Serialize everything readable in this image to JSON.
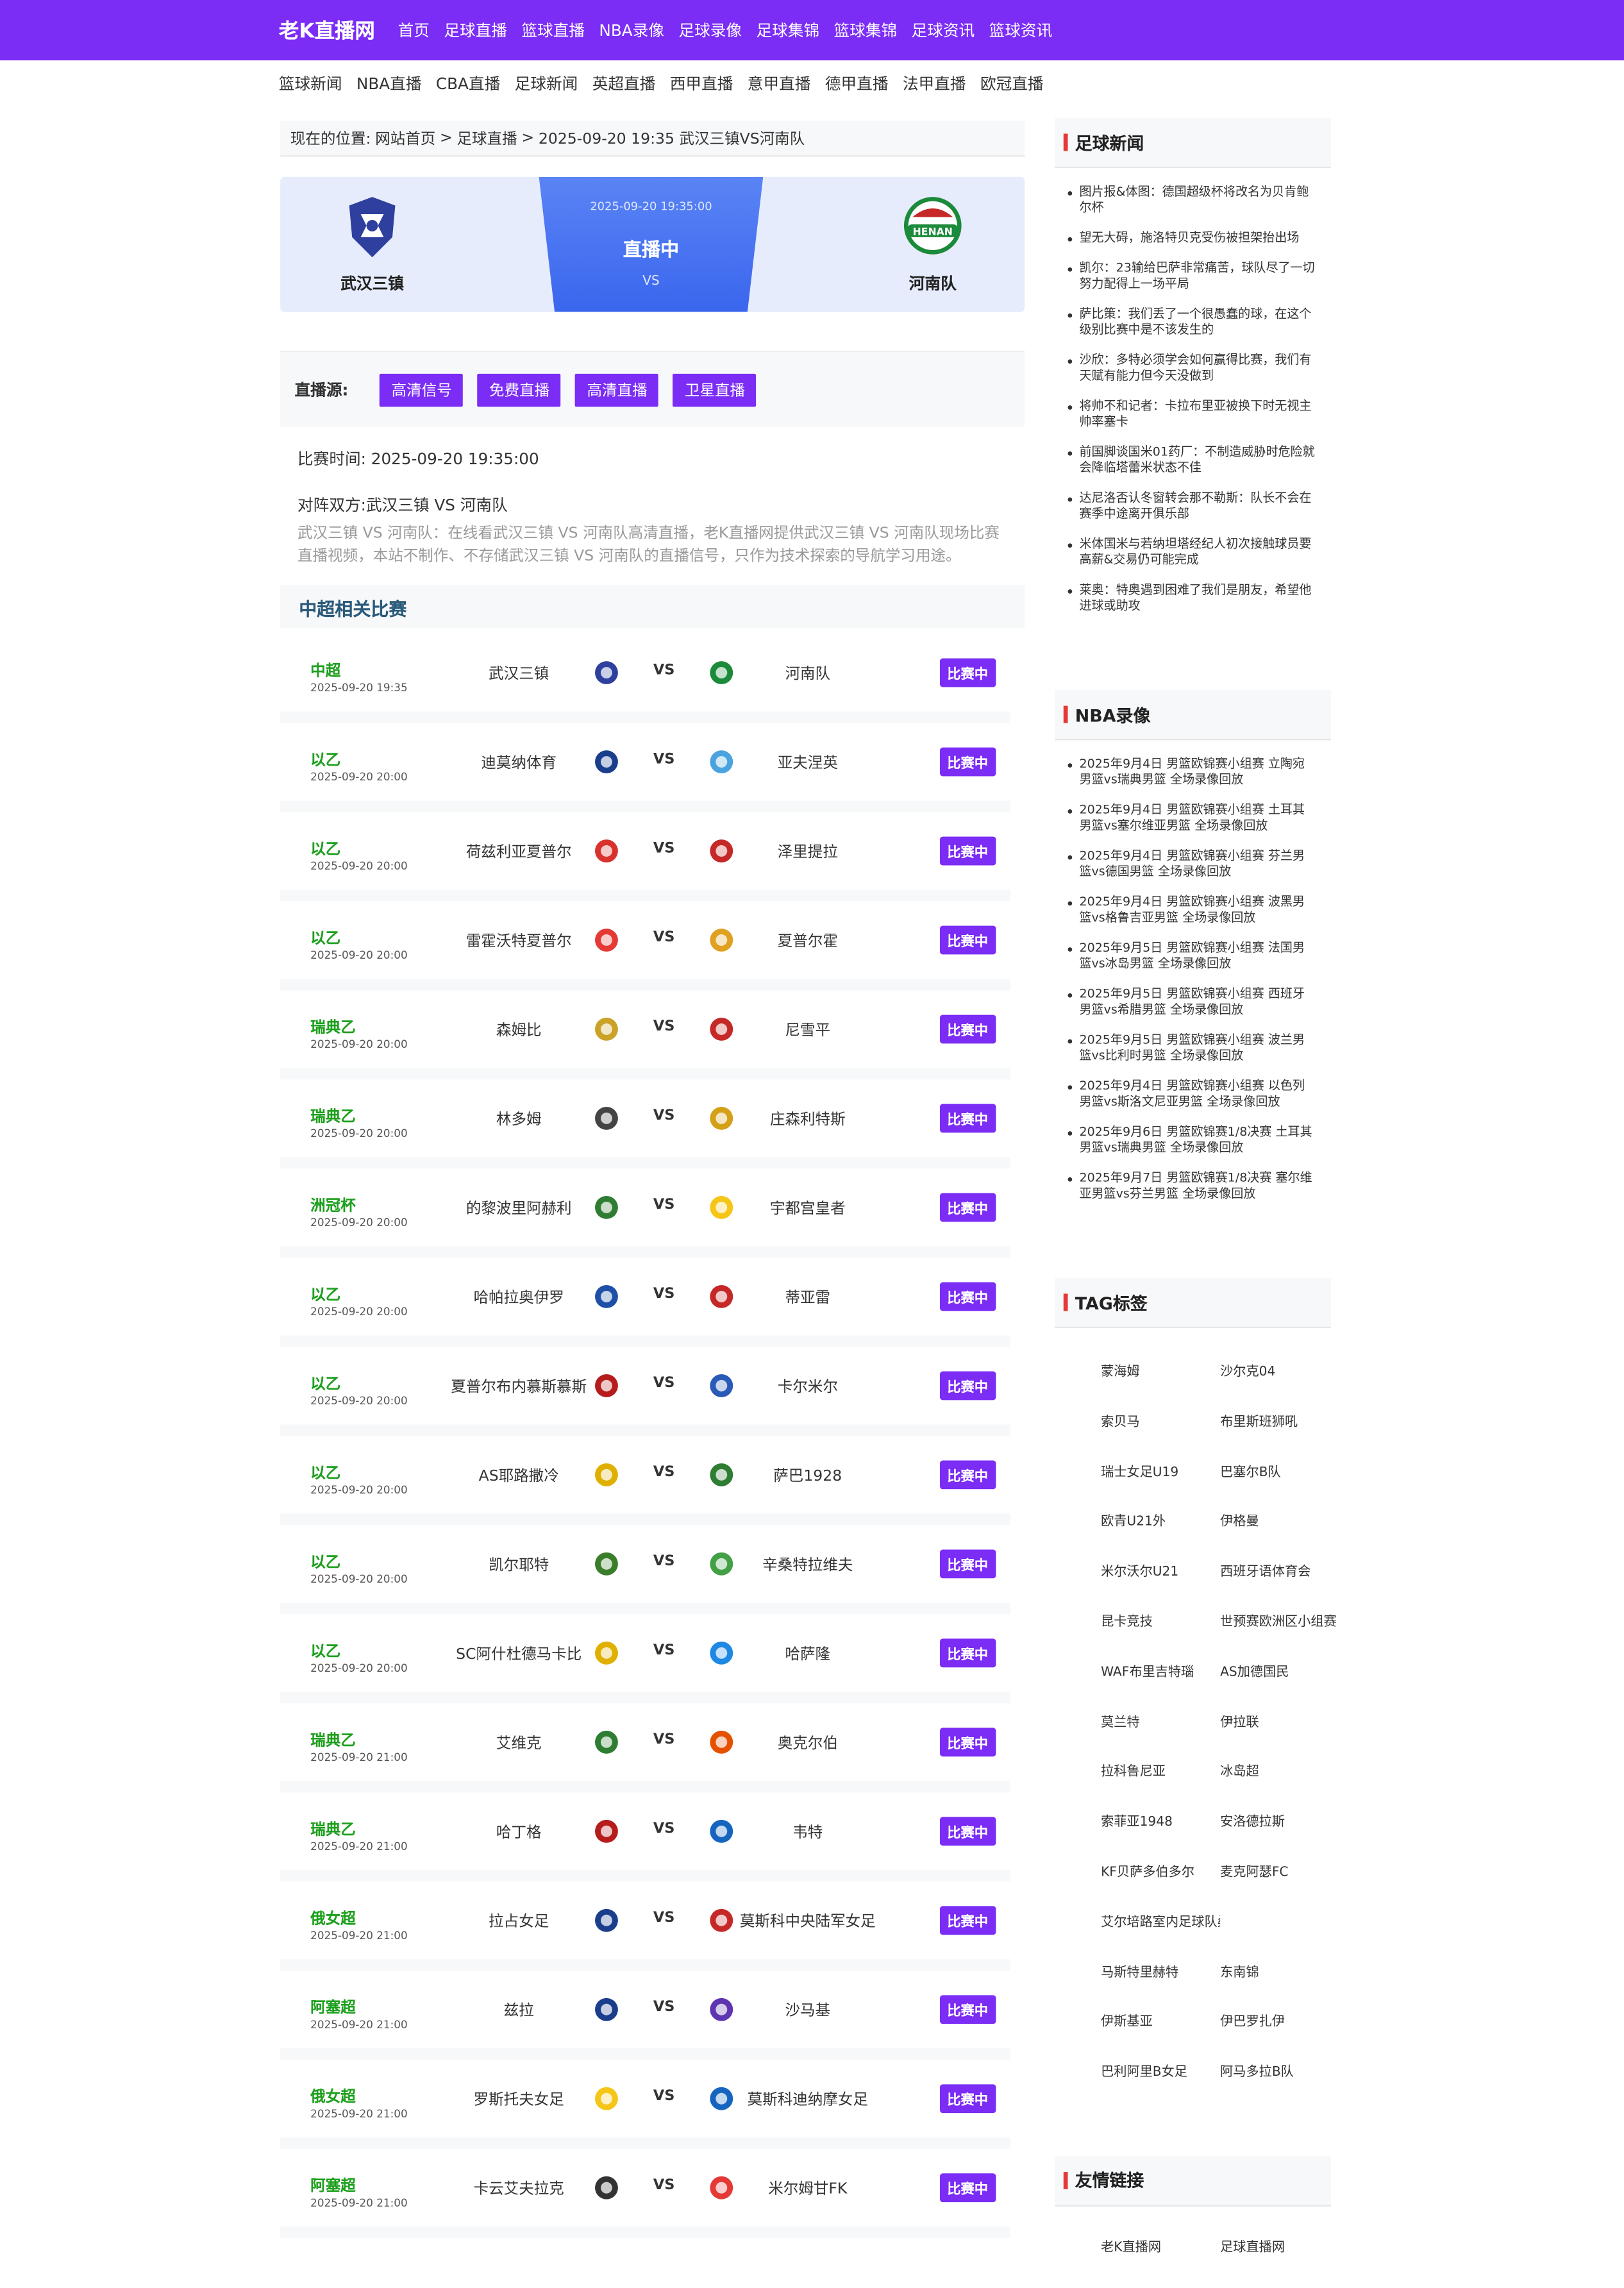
{
  "site": {
    "logo": "老K直播网"
  },
  "top_nav": [
    "首页",
    "足球直播",
    "篮球直播",
    "NBA录像",
    "足球录像",
    "足球集锦",
    "篮球集锦",
    "足球资讯",
    "篮球资讯"
  ],
  "sub_nav": [
    "篮球新闻",
    "NBA直播",
    "CBA直播",
    "足球新闻",
    "英超直播",
    "西甲直播",
    "意甲直播",
    "德甲直播",
    "法甲直播",
    "欧冠直播"
  ],
  "breadcrumb": {
    "prefix": "现在的位置:",
    "home": "网站首页",
    "sep": ">",
    "section": "足球直播",
    "current": "2025-09-20 19:35 武汉三镇VS河南队"
  },
  "banner": {
    "home_team": "武汉三镇",
    "away_team": "河南队",
    "time": "2025-09-20 19:35:00",
    "status": "直播中",
    "vs": "VS"
  },
  "sources": {
    "label": "直播源:",
    "buttons": [
      "高清信号",
      "免费直播",
      "高清直播",
      "卫星直播"
    ]
  },
  "info": {
    "match_time": "比赛时间: 2025-09-20 19:35:00",
    "teams": "对阵双方:武汉三镇 VS 河南队",
    "description": "武汉三镇 VS 河南队：在线看武汉三镇 VS 河南队高清直播，老K直播网提供武汉三镇 VS 河南队现场比赛直播视频，本站不制作、不存储武汉三镇 VS 河南队的直播信号，只作为技术探索的导航学习用途。"
  },
  "related": {
    "title": "中超相关比赛",
    "vs": "VS",
    "matches": [
      {
        "league": "中超",
        "time": "2025-09-20 19:35",
        "home": "武汉三镇",
        "away": "河南队",
        "status": "比赛中",
        "hc": "#2e3f9e",
        "ac": "#1b8a3a"
      },
      {
        "league": "以乙",
        "time": "2025-09-20 20:00",
        "home": "迪莫纳体育",
        "away": "亚夫涅英",
        "status": "比赛中",
        "hc": "#1a3e8c",
        "ac": "#4aa3df"
      },
      {
        "league": "以乙",
        "time": "2025-09-20 20:00",
        "home": "荷兹利亚夏普尔",
        "away": "泽里提拉",
        "status": "比赛中",
        "hc": "#d9322e",
        "ac": "#c62828"
      },
      {
        "league": "以乙",
        "time": "2025-09-20 20:00",
        "home": "雷霍沃特夏普尔",
        "away": "夏普尔霍",
        "status": "比赛中",
        "hc": "#e53935",
        "ac": "#e0a020"
      },
      {
        "league": "瑞典乙",
        "time": "2025-09-20 20:00",
        "home": "森姆比",
        "away": "尼雪平",
        "status": "比赛中",
        "hc": "#c9a227",
        "ac": "#c62828"
      },
      {
        "league": "瑞典乙",
        "time": "2025-09-20 20:00",
        "home": "林多姆",
        "away": "庄森利特斯",
        "status": "比赛中",
        "hc": "#444444",
        "ac": "#d4a017"
      },
      {
        "league": "洲冠杯",
        "time": "2025-09-20 20:00",
        "home": "的黎波里阿赫利",
        "away": "宇都宫皇者",
        "status": "比赛中",
        "hc": "#2e7d32",
        "ac": "#f5c518"
      },
      {
        "league": "以乙",
        "time": "2025-09-20 20:00",
        "home": "哈帕拉奥伊罗",
        "away": "蒂亚雷",
        "status": "比赛中",
        "hc": "#1f4fa8",
        "ac": "#c62828"
      },
      {
        "league": "以乙",
        "time": "2025-09-20 20:00",
        "home": "夏普尔布内慕斯慕斯",
        "away": "卡尔米尔",
        "status": "比赛中",
        "hc": "#b71c1c",
        "ac": "#2a5ab8"
      },
      {
        "league": "以乙",
        "time": "2025-09-20 20:00",
        "home": "AS耶路撒冷",
        "away": "萨巴1928",
        "status": "比赛中",
        "hc": "#e0b000",
        "ac": "#2e7d32"
      },
      {
        "league": "以乙",
        "time": "2025-09-20 20:00",
        "home": "凯尔耶特",
        "away": "辛桑特拉维夫",
        "status": "比赛中",
        "hc": "#3a7d2a",
        "ac": "#43a047"
      },
      {
        "league": "以乙",
        "time": "2025-09-20 20:00",
        "home": "SC阿什杜德马卡比",
        "away": "哈萨隆",
        "status": "比赛中",
        "hc": "#e0b000",
        "ac": "#1e88e5"
      },
      {
        "league": "瑞典乙",
        "time": "2025-09-20 21:00",
        "home": "艾维克",
        "away": "奥克尔伯",
        "status": "比赛中",
        "hc": "#2e7d32",
        "ac": "#e65100"
      },
      {
        "league": "瑞典乙",
        "time": "2025-09-20 21:00",
        "home": "哈丁格",
        "away": "韦特",
        "status": "比赛中",
        "hc": "#b71c1c",
        "ac": "#1565c0"
      },
      {
        "league": "俄女超",
        "time": "2025-09-20 21:00",
        "home": "拉占女足",
        "away": "莫斯科中央陆军女足",
        "status": "比赛中",
        "hc": "#1a3e8c",
        "ac": "#c62828"
      },
      {
        "league": "阿塞超",
        "time": "2025-09-20 21:00",
        "home": "兹拉",
        "away": "沙马基",
        "status": "比赛中",
        "hc": "#1a3e8c",
        "ac": "#5e35b1"
      },
      {
        "league": "俄女超",
        "time": "2025-09-20 21:00",
        "home": "罗斯托夫女足",
        "away": "莫斯科迪纳摩女足",
        "status": "比赛中",
        "hc": "#f5c518",
        "ac": "#1565c0"
      },
      {
        "league": "阿塞超",
        "time": "2025-09-20 21:00",
        "home": "卡云艾夫拉克",
        "away": "米尔姆甘FK",
        "status": "比赛中",
        "hc": "#333333",
        "ac": "#e53935"
      }
    ]
  },
  "sidebar": {
    "football_news": {
      "title": "足球新闻",
      "items": [
        "图片报&体图：德国超级杯将改名为贝肯鲍尔杯",
        "望无大碍，施洛特贝克受伤被担架抬出场",
        "凯尔：23输给巴萨非常痛苦，球队尽了一切努力配得上一场平局",
        "萨比策：我们丢了一个很愚蠢的球，在这个级别比赛中是不该发生的",
        "沙欣：多特必须学会如何赢得比赛，我们有天赋有能力但今天没做到",
        "将帅不和记者：卡拉布里亚被换下时无视主帅率塞卡",
        "前国脚谈国米01药厂：不制造威胁时危险就会降临塔蕾米状态不佳",
        "达尼洛否认冬窗转会那不勒斯：队长不会在赛季中途离开俱乐部",
        "米体国米与若纳坦塔经纪人初次接触球员要高薪&交易仍可能完成",
        "莱奥：特奥遇到困难了我们是朋友，希望他进球或助攻"
      ]
    },
    "nba_replay": {
      "title": "NBA录像",
      "items": [
        "2025年9月4日 男篮欧锦赛小组赛 立陶宛男篮vs瑞典男篮 全场录像回放",
        "2025年9月4日 男篮欧锦赛小组赛 土耳其男篮vs塞尔维亚男篮 全场录像回放",
        "2025年9月4日 男篮欧锦赛小组赛 芬兰男篮vs德国男篮 全场录像回放",
        "2025年9月4日 男篮欧锦赛小组赛 波黑男篮vs格鲁吉亚男篮 全场录像回放",
        "2025年9月5日 男篮欧锦赛小组赛 法国男篮vs冰岛男篮 全场录像回放",
        "2025年9月5日 男篮欧锦赛小组赛 西班牙男篮vs希腊男篮 全场录像回放",
        "2025年9月5日 男篮欧锦赛小组赛 波兰男篮vs比利时男篮 全场录像回放",
        "2025年9月4日 男篮欧锦赛小组赛 以色列男篮vs斯洛文尼亚男篮 全场录像回放",
        "2025年9月6日 男篮欧锦赛1/8决赛 土耳其男篮vs瑞典男篮 全场录像回放",
        "2025年9月7日 男篮欧锦赛1/8决赛 塞尔维亚男篮vs芬兰男篮 全场录像回放"
      ]
    },
    "tags": {
      "title": "TAG标签",
      "items": [
        "蒙海姆",
        "沙尔克04",
        "索贝马",
        "布里斯班狮吼",
        "瑞士女足U19",
        "巴塞尔B队",
        "欧青U21外",
        "伊格曼",
        "米尔沃尔U21",
        "西班牙语体育会",
        "昆卡竞技",
        "世预赛欧洲区小组赛",
        "WAF布里吉特瑙",
        "AS加德国民",
        "莫兰特",
        "伊拉联",
        "拉科鲁尼亚",
        "冰岛超",
        "索菲亚1948",
        "安洛德拉斯",
        "KF贝萨多伯多尔",
        "麦克阿瑟FC",
        "艾尔培路室内足球队桑给超",
        "",
        "马斯特里赫特",
        "东南锦",
        "伊斯基亚",
        "伊巴罗扎伊",
        "巴利阿里B女足",
        "阿马多拉B队"
      ]
    },
    "links": {
      "title": "友情链接",
      "items": [
        "老K直播网",
        "足球直播网"
      ]
    }
  }
}
